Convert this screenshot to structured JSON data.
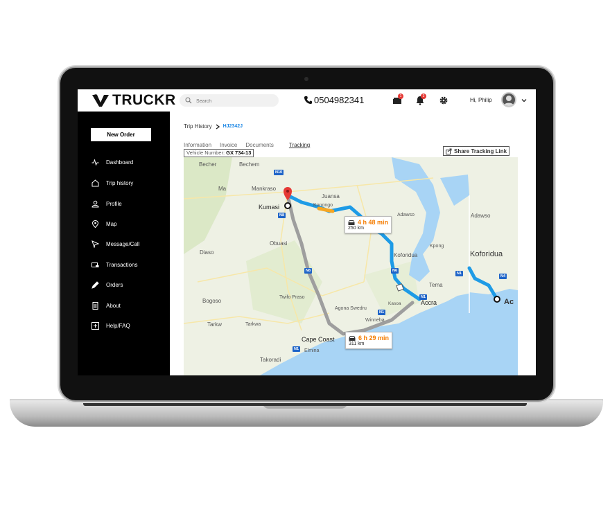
{
  "brand": {
    "name": "TRUCKR"
  },
  "topbar": {
    "search_placeholder": "Search",
    "phone": "0504982341",
    "messages_badge": "1",
    "notifications_badge": "3",
    "greeting": "Hi, Philip"
  },
  "sidebar": {
    "new_order": "New Order",
    "items": [
      {
        "label": "Dashboard",
        "icon": "activity-icon"
      },
      {
        "label": "Trip history",
        "icon": "home-icon"
      },
      {
        "label": "Profile",
        "icon": "user-icon"
      },
      {
        "label": "Map",
        "icon": "map-pin-icon"
      },
      {
        "label": "Message/Call",
        "icon": "send-icon"
      },
      {
        "label": "Transactions",
        "icon": "card-icon"
      },
      {
        "label": "Orders",
        "icon": "pen-icon"
      },
      {
        "label": "About",
        "icon": "document-icon"
      },
      {
        "label": "Help/FAQ",
        "icon": "plus-square-icon"
      }
    ]
  },
  "main": {
    "breadcrumb": {
      "parent": "Trip History",
      "current": "HJ2342J"
    },
    "tabs": [
      "Information",
      "Invoice",
      "Documents",
      "Tracking"
    ],
    "active_tab": "Tracking",
    "vehicle_label": "Vehicle Number:",
    "vehicle_number": "GX 734-13",
    "share_label": "Share Tracking Link"
  },
  "map": {
    "routes": [
      {
        "time": "4 h 48 min",
        "distance": "250 km"
      },
      {
        "time": "6 h 29 min",
        "distance": "311 km"
      }
    ],
    "places": [
      "Becher",
      "Bechem",
      "Mankraso",
      "Juansa",
      "Kumasi",
      "Konongo",
      "Adawso",
      "Ma",
      "Obuasi",
      "Koforidua",
      "Kpong",
      "Diaso",
      "Tema",
      "Accra",
      "Bogoso",
      "Twifo Praso",
      "Agona Swedru",
      "Kasoa",
      "Winneba",
      "Tarkw",
      "Tarkwa",
      "Cape Coast",
      "Elmina",
      "Takoradi",
      "Adawso",
      "Koforidua",
      "Ac"
    ],
    "roads": [
      "N10",
      "N8",
      "N8",
      "N6",
      "N1",
      "N1",
      "N1",
      "N1",
      "N4"
    ],
    "colors": {
      "route_primary": "#1e9be6",
      "route_alt": "#9e9e9e",
      "traffic": "#f5a623",
      "water": "#a8d4f5",
      "land": "#eef1e4"
    }
  },
  "colors": {
    "accent": "#1e88e5",
    "sidebar_bg": "#000000",
    "badge": "#e53935"
  }
}
